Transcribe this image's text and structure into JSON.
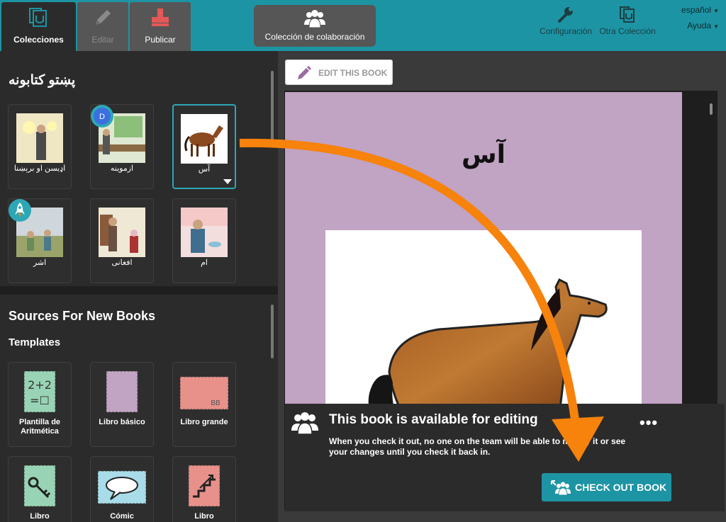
{
  "toolbar": {
    "tabs": {
      "collections": "Colecciones",
      "edit": "Editar",
      "publish": "Publicar"
    },
    "collaboration_button": "Colección de colaboración",
    "settings": "Configuración",
    "other_collection": "Otra Colección",
    "language": "español",
    "help": "Ayuda"
  },
  "left_pane": {
    "collection_heading": "پښتو کتابونه",
    "books": [
      {
        "label": "اډيسن او برېښنا"
      },
      {
        "label": "ازموينه",
        "badge": "D"
      },
      {
        "label": "آس"
      },
      {
        "label": "اشر"
      },
      {
        "label": "افغانی"
      },
      {
        "label": "ام"
      }
    ],
    "sources_heading": "Sources For New Books",
    "templates_heading": "Templates",
    "templates": [
      {
        "label": "Plantilla de Aritmética",
        "thumb_text": "2+2\n=☐"
      },
      {
        "label": "Libro básico"
      },
      {
        "label": "Libro grande",
        "thumb_text": "BB"
      },
      {
        "label": "Libro"
      },
      {
        "label": "Cómic"
      },
      {
        "label": "Libro"
      }
    ]
  },
  "right_pane": {
    "edit_button": "EDIT THIS BOOK",
    "book_title": "آس",
    "checkout": {
      "title": "This book is available for editing",
      "description": "When you check it out, no one on the team will be able to modify it or see your changes until you check it back in.",
      "more": "•••",
      "button": "CHECK OUT BOOK"
    }
  },
  "colors": {
    "toolbar": "#1d94a4",
    "background": "#2b2b2b",
    "selected_border": "#2da7b5",
    "book_page": "#c1a3c3",
    "arrow": "#f7820c"
  },
  "icons": {
    "collections": "collections-icon",
    "edit": "pencil-icon",
    "publish": "publish-icon",
    "collaboration": "team-icon",
    "settings": "wrench-icon",
    "other_collection": "collections-icon"
  }
}
